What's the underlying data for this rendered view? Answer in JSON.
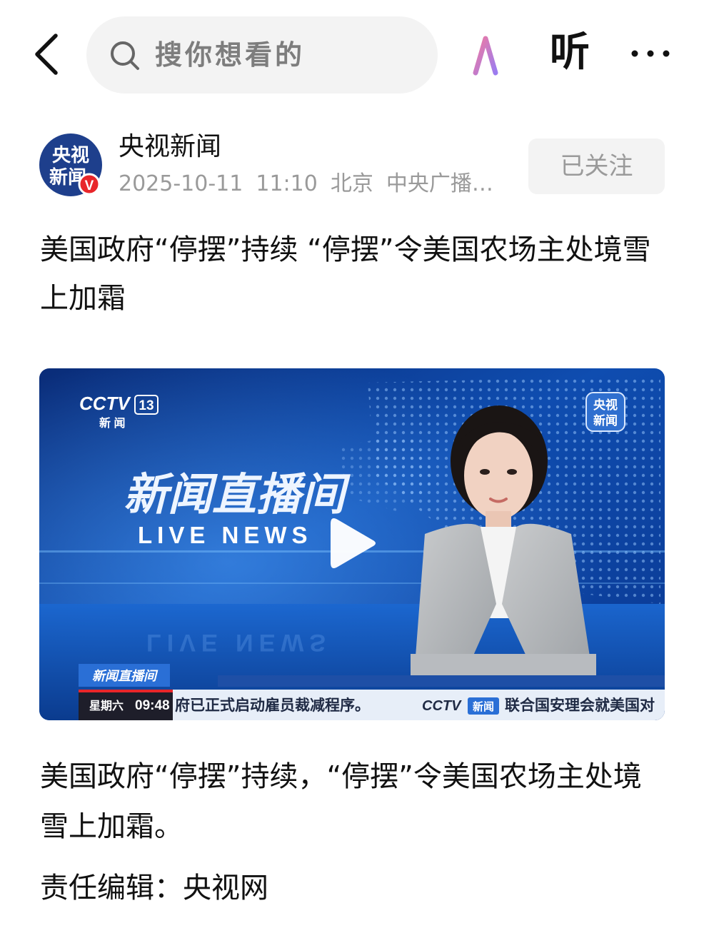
{
  "header": {
    "search_placeholder": "搜你想看的",
    "ai_label": "AI",
    "listen_label": "听",
    "more_label": "···"
  },
  "author": {
    "name": "央视新闻",
    "avatar_text_line1": "央视",
    "avatar_text_line2": "新闻",
    "verified_badge": "V",
    "date": "2025-10-11",
    "time": "11:10",
    "location": "北京",
    "source": "中央广播电...",
    "follow_label": "已关注"
  },
  "article": {
    "headline": "美国政府“停摆”持续 “停摆”令美国农场主处境雪上加霜",
    "body": "美国政府“停摆”持续，“停摆”令美国农场主处境雪上加霜。",
    "editor": "责任编辑：央视网"
  },
  "video": {
    "channel_logo": "CCTV",
    "channel_number": "13",
    "channel_subtitle": "新  闻",
    "corner_logo_line1": "央视",
    "corner_logo_line2": "新闻",
    "program_title_cn": "新闻直播间",
    "program_title_en": "LIVE NEWS",
    "lower_third_program": "新闻直播间",
    "lower_third_day": "星期六",
    "lower_third_time": "09:48",
    "ticker_left": "府已正式启动雇员裁减程序。",
    "ticker_logo": "CCTV",
    "ticker_logo_tag": "新闻",
    "ticker_right": "联合国安理会就美国对"
  },
  "colors": {
    "text_primary": "#111111",
    "text_secondary": "#9a9a9a",
    "search_bg": "#f3f3f3",
    "ai_gradient_start": "#f07aa0",
    "ai_gradient_end": "#9b7cf0",
    "avatar_bg": "#1e3f8c",
    "verified_red": "#e8262a",
    "studio_blue": "#0f4db0"
  }
}
